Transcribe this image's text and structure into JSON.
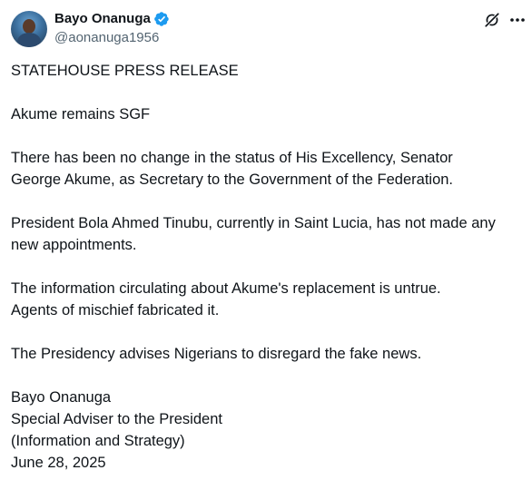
{
  "author": {
    "display_name": "Bayo Onanuga",
    "handle": "@aonanuga1956",
    "verified_color": "#1d9bf0"
  },
  "icons": {
    "verified": "verified-badge-icon",
    "grok": "grok-icon",
    "more": "more-options-icon"
  },
  "tweet": {
    "lines": [
      "STATEHOUSE PRESS RELEASE",
      "",
      "Akume remains SGF",
      "",
      "There has been no change in the status of His Excellency, Senator",
      "George Akume, as Secretary to the Government of the Federation.",
      "",
      "President Bola Ahmed Tinubu, currently in Saint Lucia, has not made any",
      "new appointments.",
      "",
      "The information circulating about Akume's replacement is untrue.",
      "Agents of mischief fabricated it.",
      "",
      "The Presidency advises Nigerians to disregard the fake news.",
      "",
      "Bayo Onanuga",
      "Special Adviser to the President",
      "(Information and Strategy)",
      "June 28, 2025"
    ]
  }
}
